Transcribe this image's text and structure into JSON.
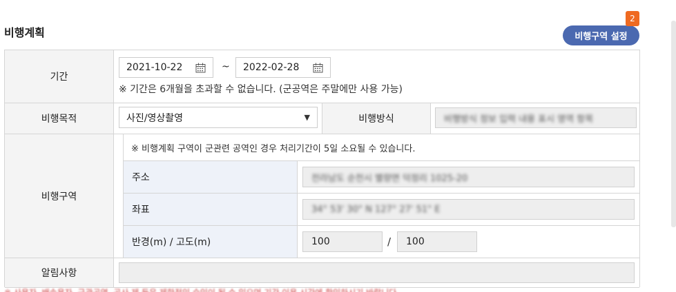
{
  "section": {
    "title": "비행계획"
  },
  "area_button": {
    "label": "비행구역 설정",
    "badge": "2"
  },
  "period": {
    "label": "기간",
    "start_date": "2021-10-22",
    "separator": "~",
    "end_date": "2022-02-28",
    "note": "※ 기간은 6개월을 초과할 수 없습니다. (군공역은 주말에만 사용 가능)"
  },
  "purpose": {
    "label": "비행목적",
    "selected": "사진/영상촬영",
    "arrow": "▼"
  },
  "method": {
    "label": "비행방식",
    "value": "비행방식 정보 입력 내용 표시 영역 항목"
  },
  "zone": {
    "label": "비행구역",
    "note": "※ 비행계획 구역이 군관련 공역인 경우 처리기간이 5일 소요될 수 있습니다.",
    "address_label": "주소",
    "address_value": "전라남도 순천시 별량면 덕정리 1025-20",
    "coord_label": "좌표",
    "coord_value": "34° 53' 30\" N 127° 27' 51\" E",
    "radius_label": "반경(m) / 고도(m)",
    "radius_value": "100",
    "altitude_value": "100",
    "slash": "/"
  },
  "notice": {
    "label": "알림사항",
    "value": ""
  },
  "footer_hint": "※ 사용자, 배송용자, 군관공역, 공사 제 등은 제한적인 승인이 될 수 있으며 기간 이용 시간에 확인하시기 바랍니다.",
  "icons": {
    "calendar": "calendar-icon",
    "dropdown": "chevron-down-icon"
  },
  "colors": {
    "accent": "#4b69b0",
    "badge": "#ef6a21",
    "label_bg": "#f4f4f4",
    "sub_label_bg": "#eef2f9"
  }
}
